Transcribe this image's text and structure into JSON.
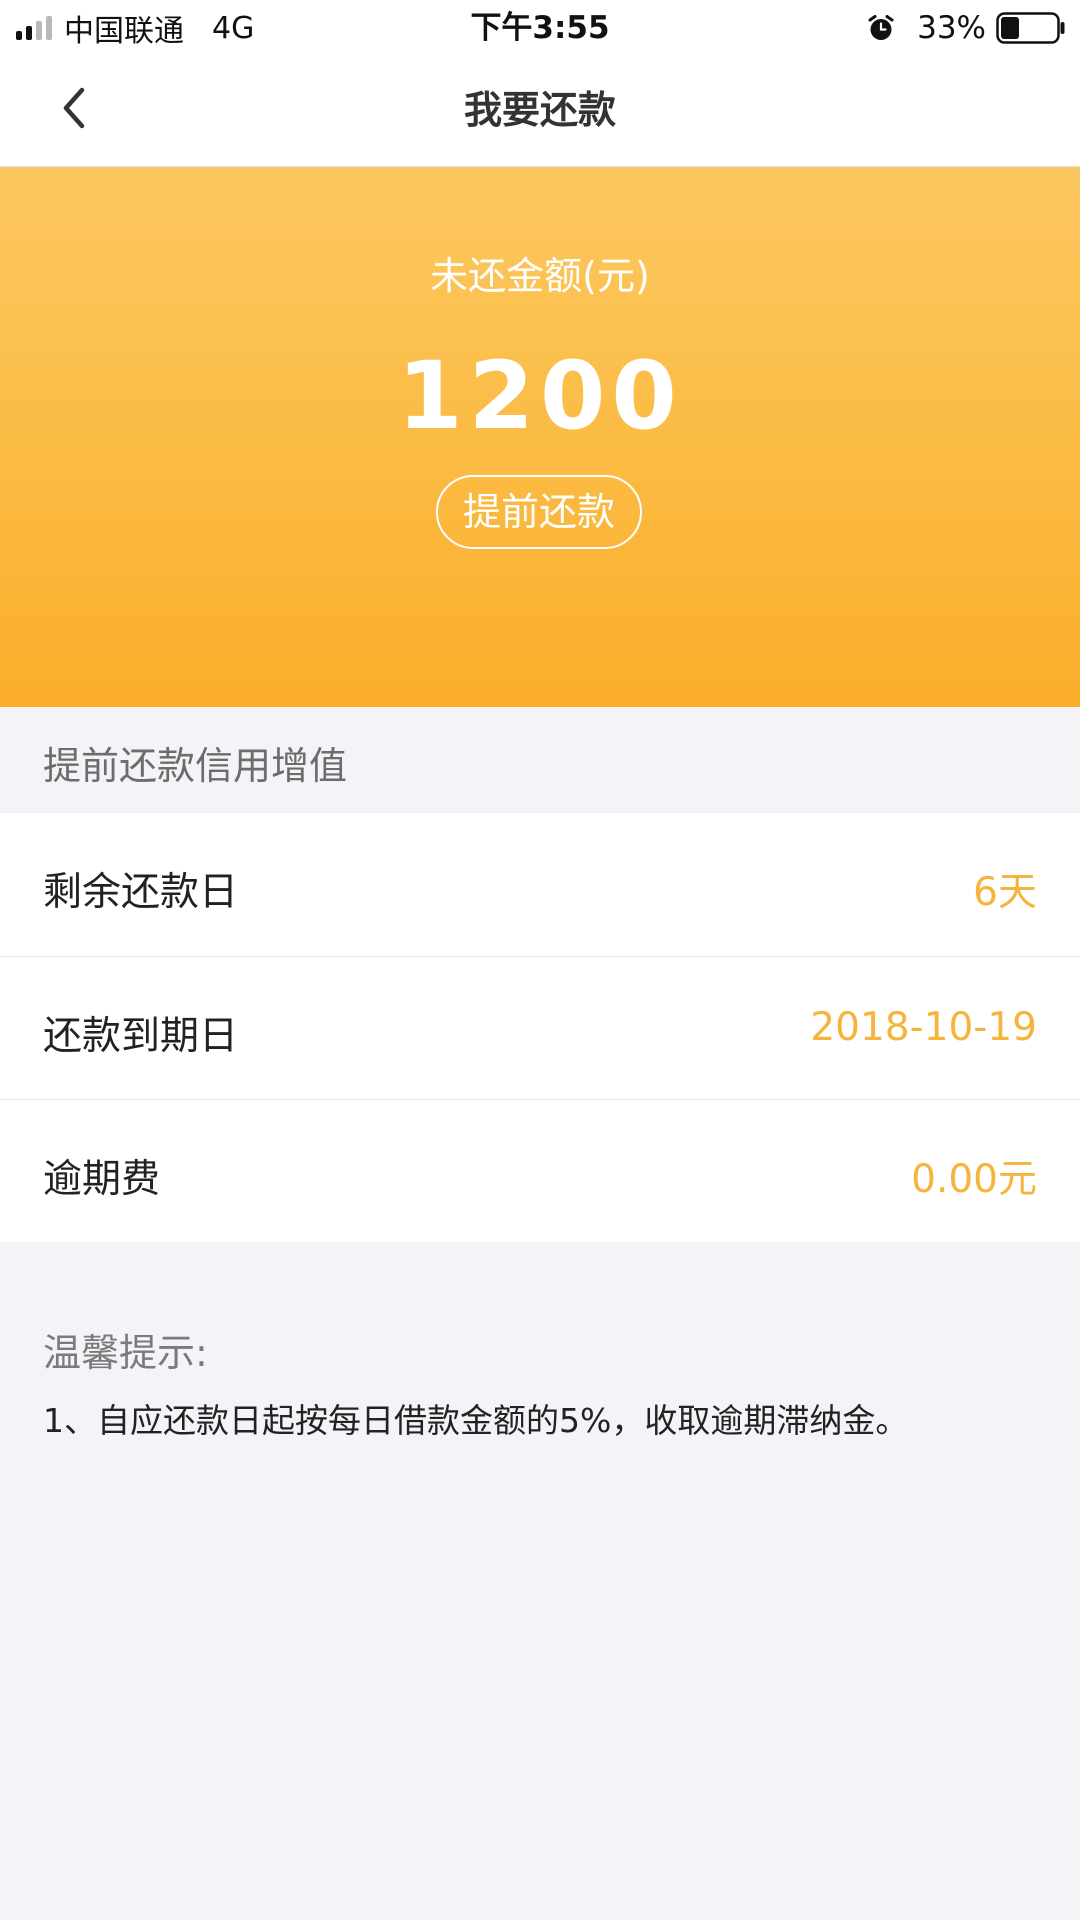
{
  "status_bar": {
    "carrier": "中国联通",
    "network": "4G",
    "time": "下午3:55",
    "battery_percent": "33%",
    "battery_level": 0.33,
    "signal_bars_active": 2,
    "signal_bars_total": 4
  },
  "nav": {
    "title": "我要还款",
    "back_icon": "chevron-left-icon"
  },
  "hero": {
    "label": "未还金额(元)",
    "amount": "1200",
    "prepay_button": "提前还款"
  },
  "section": {
    "title": "提前还款信用增值"
  },
  "info": {
    "rows": [
      {
        "label": "剩余还款日",
        "value": "6天"
      },
      {
        "label": "还款到期日",
        "value": "2018-10-19"
      },
      {
        "label": "逾期费",
        "value": "0.00元"
      }
    ]
  },
  "tips": {
    "title": "温馨提示:",
    "items": [
      "1、自应还款日起按每日借款金额的5%，收取逾期滞纳金。"
    ]
  },
  "colors": {
    "accent": "#f5b43c",
    "hero_top": "#fcc760",
    "hero_bottom": "#fbae2a",
    "page_background": "#f3f4f7"
  }
}
